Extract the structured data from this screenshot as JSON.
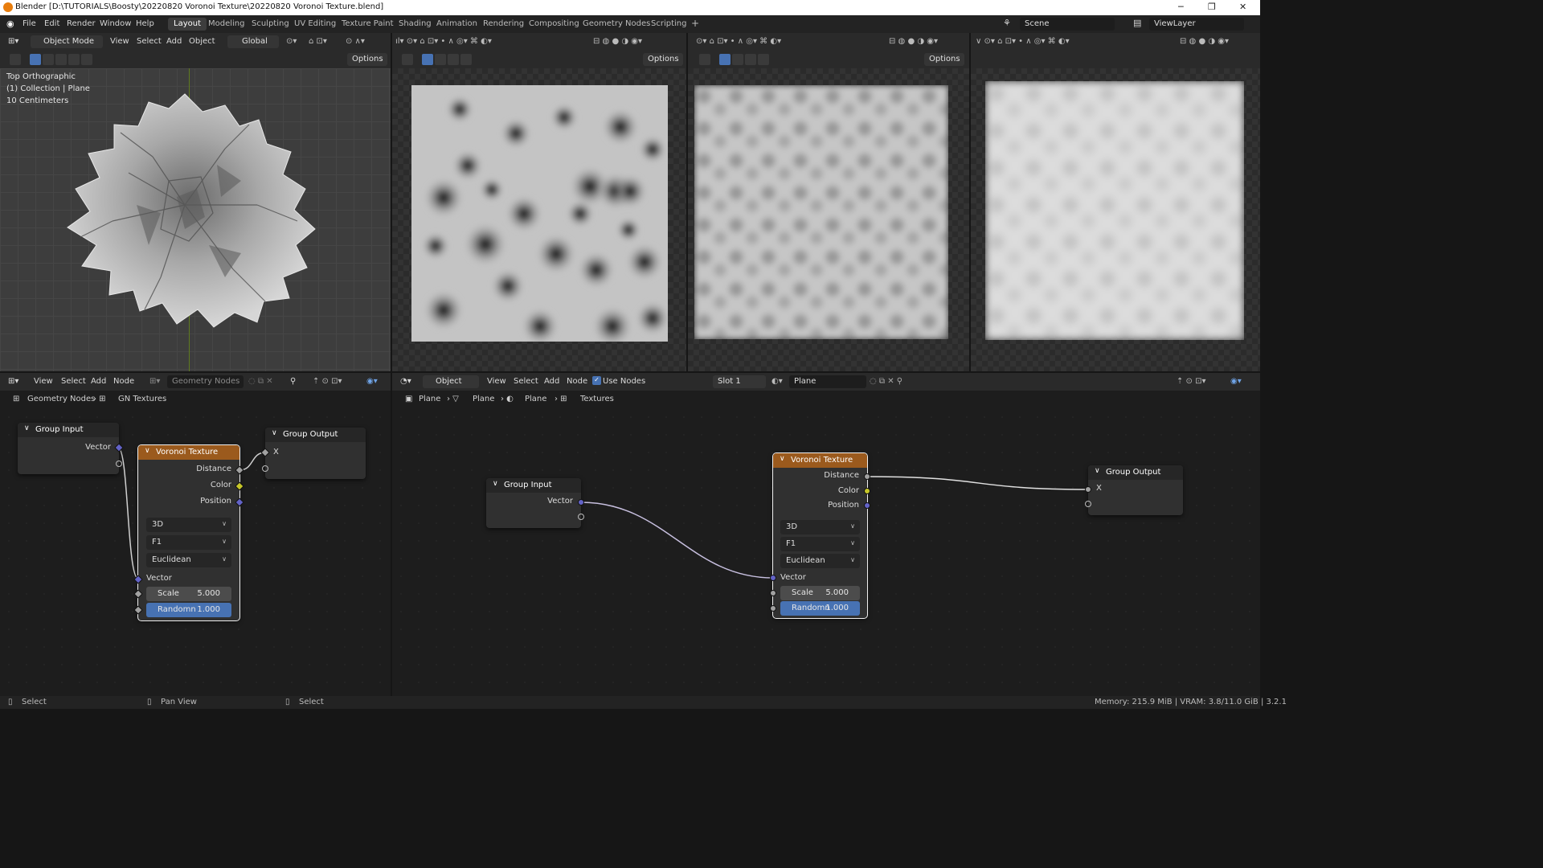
{
  "window": {
    "title": "Blender [D:\\TUTORIALS\\Boosty\\20220820 Voronoi Texture\\20220820 Voronoi Texture.blend]",
    "minimize": "─",
    "restore": "❐",
    "close": "✕"
  },
  "menu": [
    "File",
    "Edit",
    "Render",
    "Window",
    "Help"
  ],
  "workspaces": [
    "Layout",
    "Modeling",
    "Sculpting",
    "UV Editing",
    "Texture Paint",
    "Shading",
    "Animation",
    "Rendering",
    "Compositing",
    "Geometry Nodes",
    "Scripting",
    "+"
  ],
  "active_workspace": "Layout",
  "scene": "Scene",
  "view_layer": "ViewLayer",
  "viewport": {
    "mode": "Object Mode",
    "menus": [
      "View",
      "Select",
      "Add",
      "Object"
    ],
    "orientation": "Global",
    "options": "Options",
    "overlay_lines": [
      "Top Orthographic",
      "(1) Collection | Plane",
      "10 Centimeters"
    ]
  },
  "node_left": {
    "menus": [
      "View",
      "Select",
      "Add",
      "Node"
    ],
    "tree_name": "Geometry Nodes",
    "breadcrumb": [
      "Geometry Nodes",
      "GN Textures"
    ]
  },
  "node_right": {
    "mode": "Object",
    "menus": [
      "View",
      "Select",
      "Add",
      "Node"
    ],
    "use_nodes": "Use Nodes",
    "slot": "Slot 1",
    "material": "Plane",
    "breadcrumb": [
      "Plane",
      "Plane",
      "Plane",
      "Textures"
    ]
  },
  "nodes": {
    "group_input": {
      "title": "Group Input",
      "output": "Vector"
    },
    "group_output": {
      "title": "Group Output",
      "input": "X"
    },
    "voronoi": {
      "title": "Voronoi Texture",
      "outputs": [
        "Distance",
        "Color",
        "Position"
      ],
      "dimensions": "3D",
      "feature": "F1",
      "metric": "Euclidean",
      "vector_input": "Vector",
      "scale_label": "Scale",
      "scale_value": "5.000",
      "random_label": "Randomn",
      "random_value": "1.000"
    }
  },
  "socket_colors": {
    "vector": "#6363c7",
    "color": "#c7c729",
    "float": "#a1a1a1"
  },
  "status": {
    "left": "Select",
    "middle": "Pan View",
    "right": "Select",
    "info": "Memory: 215.9 MiB | VRAM: 3.8/11.0 GiB | 3.2.1"
  }
}
